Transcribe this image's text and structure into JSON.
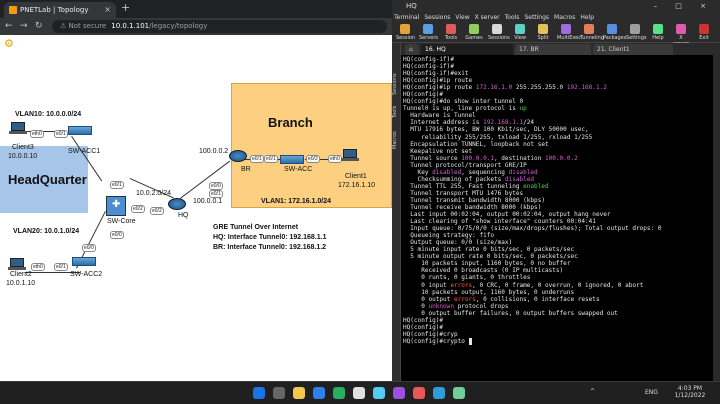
{
  "browser": {
    "tab_title": "PNETLab | Topology",
    "tab_close": "×",
    "new_tab": "+",
    "nav": {
      "back": "←",
      "forward": "→",
      "reload": "↻"
    },
    "url": {
      "not_secure": "⚠ Not secure",
      "host": "10.0.1.101",
      "path": "/legacy/topology"
    }
  },
  "topology": {
    "branch_title": "Branch",
    "hq_title": "HeadQuarter",
    "vlan10": "VLAN10: 10.0.0.0/24",
    "vlan20": "VLAN20: 10.0.1.0/24",
    "vlan1": "VLAN1: 172.16.1.0/24",
    "client3": {
      "name": "Client3",
      "ip": "10.0.0.10"
    },
    "client2": {
      "name": "Client2",
      "ip": "10.0.1.10"
    },
    "client1": {
      "name": "Client1",
      "ip": "172.16.1.10"
    },
    "sw_acc1": "SW-ACC1",
    "sw_acc2": "SW-ACC2",
    "sw_core": "SW-Core",
    "sw_acc": "SW-ACC",
    "hq": "HQ",
    "br": "BR",
    "net_core_hq": "10.0.2.0/24",
    "ip_100_0_0_1": "100.0.0.1",
    "ip_100_0_0_2": "100.0.0.2",
    "gre_title": "GRE Tunnel Over Internet",
    "gre_hq": "HQ: Interface Tunnel0: 192.168.1.1",
    "gre_br": "BR: Interface Tunnel0: 192.168.1.2",
    "ports": {
      "eth0": "eth0",
      "e0_1": "e0/1",
      "e0_2": "e0/2",
      "e0_0": "e0/0"
    }
  },
  "moba": {
    "window_title": "HQ",
    "window_controls": "– □ ×",
    "menu": [
      "Terminal",
      "Sessions",
      "View",
      "X server",
      "Tools",
      "Settings",
      "Macros",
      "Help"
    ],
    "toolbar": [
      "Session",
      "Servers",
      "Tools",
      "Games",
      "Sessions",
      "View",
      "Split",
      "MultiExec",
      "Tunneling",
      "Packages",
      "Settings",
      "Help",
      "X server",
      "Exit"
    ],
    "side": [
      "Sessions",
      "Tools",
      "Macros"
    ],
    "tabs": [
      "16. HQ",
      "17. BR",
      "21. Client1"
    ],
    "terminal_lines": [
      [
        [
          "HQ(config-if)#",
          ""
        ]
      ],
      [
        [
          "HQ(config-if)#",
          ""
        ]
      ],
      [
        [
          "HQ(config-if)#exit",
          ""
        ]
      ],
      [
        [
          "HQ(config)#ip route",
          ""
        ]
      ],
      [
        [
          "HQ(config)#ip route ",
          ""
        ],
        [
          "172.16.1.0",
          "m"
        ],
        [
          " 255.255.255.0 ",
          ""
        ],
        [
          "192.168.1.2",
          "m"
        ]
      ],
      [
        [
          "HQ(config)#",
          ""
        ]
      ],
      [
        [
          "HQ(config)#do show inter tunnel 0",
          ""
        ]
      ],
      [
        [
          "Tunnel0 is up, line protocol is ",
          ""
        ],
        [
          "up",
          "g"
        ]
      ],
      [
        [
          "  Hardware is Tunnel",
          ""
        ]
      ],
      [
        [
          "  Internet address is ",
          ""
        ],
        [
          "192.168.1.1",
          "m"
        ],
        [
          "/24",
          ""
        ]
      ],
      [
        [
          "  MTU 17916 bytes, BW 100 Kbit/sec, DLY 50000 usec,",
          ""
        ]
      ],
      [
        [
          "     reliability 255/255, txload 1/255, rxload 1/255",
          ""
        ]
      ],
      [
        [
          "  Encapsulation TUNNEL, loopback not set",
          ""
        ]
      ],
      [
        [
          "  Keepalive not set",
          ""
        ]
      ],
      [
        [
          "  Tunnel source ",
          ""
        ],
        [
          "100.0.0.1",
          "m"
        ],
        [
          ", destination ",
          ""
        ],
        [
          "100.0.0.2",
          "m"
        ]
      ],
      [
        [
          "  Tunnel protocol/transport GRE/IP",
          ""
        ]
      ],
      [
        [
          "    Key ",
          ""
        ],
        [
          "disabled",
          "m"
        ],
        [
          ", sequencing ",
          ""
        ],
        [
          "disabled",
          "m"
        ]
      ],
      [
        [
          "    Checksumming of packets ",
          ""
        ],
        [
          "disabled",
          "m"
        ]
      ],
      [
        [
          "  Tunnel TTL 255, Fast tunneling ",
          ""
        ],
        [
          "enabled",
          "g"
        ]
      ],
      [
        [
          "  Tunnel transport MTU 1476 bytes",
          ""
        ]
      ],
      [
        [
          "  Tunnel transmit bandwidth 8000 (kbps)",
          ""
        ]
      ],
      [
        [
          "  Tunnel receive bandwidth 8000 (kbps)",
          ""
        ]
      ],
      [
        [
          "  Last input 00:02:04, output 00:02:04, output hang never",
          ""
        ]
      ],
      [
        [
          "  Last clearing of \"show interface\" counters 00:04:41",
          ""
        ]
      ],
      [
        [
          "  Input queue: 0/75/0/0 (size/max/drops/flushes); Total output drops: 0",
          ""
        ]
      ],
      [
        [
          "  Queueing strategy: fifo",
          ""
        ]
      ],
      [
        [
          "  Output queue: 0/0 (size/max)",
          ""
        ]
      ],
      [
        [
          "  5 minute input rate 0 bits/sec, 0 packets/sec",
          ""
        ]
      ],
      [
        [
          "  5 minute output rate 0 bits/sec, 0 packets/sec",
          ""
        ]
      ],
      [
        [
          "     10 packets input, 1160 bytes, 0 no buffer",
          ""
        ]
      ],
      [
        [
          "     Received 0 broadcasts (0 IP multicasts)",
          ""
        ]
      ],
      [
        [
          "     0 runts, 0 giants, 0 throttles",
          ""
        ]
      ],
      [
        [
          "     0 input ",
          ""
        ],
        [
          "errors",
          "r"
        ],
        [
          ", 0 CRC, 0 frame, 0 overrun, 0 ignored, 0 abort",
          ""
        ]
      ],
      [
        [
          "     10 packets output, 1160 bytes, 0 underruns",
          ""
        ]
      ],
      [
        [
          "     0 output ",
          ""
        ],
        [
          "errors",
          "r"
        ],
        [
          ", 0 collisions, 0 interface resets",
          ""
        ]
      ],
      [
        [
          "     0 ",
          ""
        ],
        [
          "unknown",
          "m"
        ],
        [
          " protocol drops",
          ""
        ]
      ],
      [
        [
          "     0 output buffer failures, 0 output buffers swapped out",
          ""
        ]
      ],
      [
        [
          "HQ(config)#",
          ""
        ]
      ],
      [
        [
          "HQ(config)#",
          ""
        ]
      ],
      [
        [
          "HQ(config)#cryp",
          ""
        ]
      ],
      [
        [
          "HQ(config)#crypto ",
          ""
        ],
        [
          " ",
          "c"
        ]
      ]
    ]
  },
  "taskbar": {
    "lang": "ENG",
    "time": "4:03 PM",
    "date": "1/12/2022",
    "tray_up": "^"
  }
}
